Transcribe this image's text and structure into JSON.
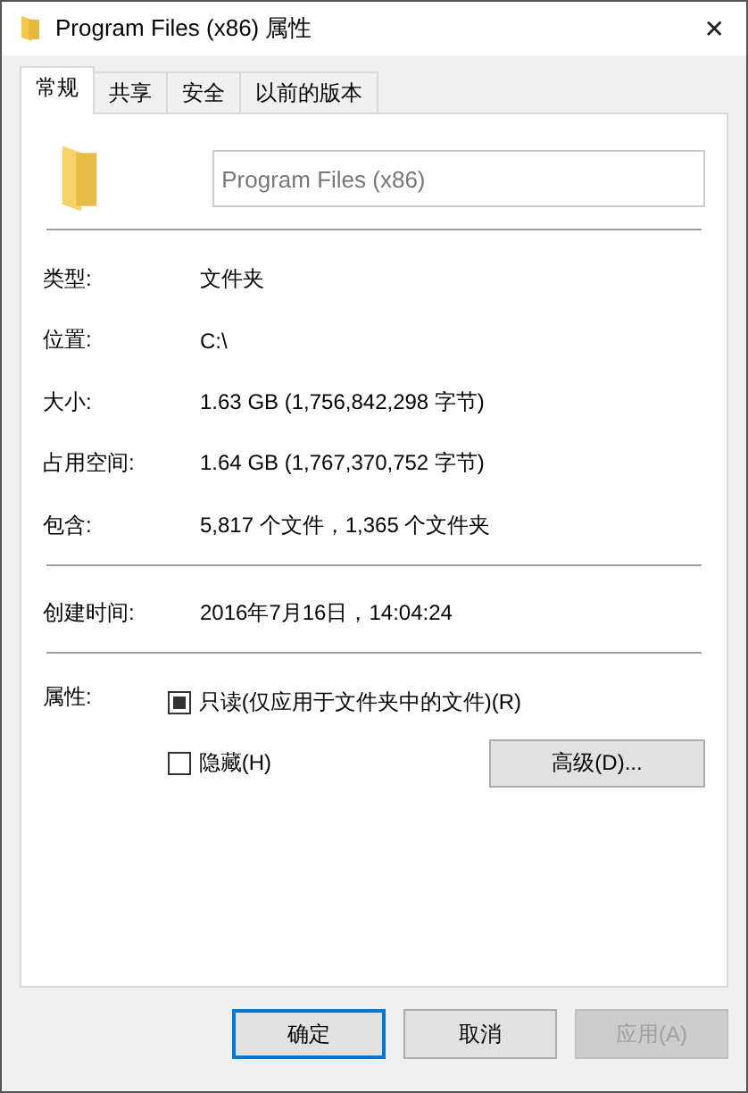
{
  "window": {
    "title": "Program Files (x86) 属性",
    "close": "✕"
  },
  "tabs": [
    {
      "label": "常规",
      "selected": true
    },
    {
      "label": "共享",
      "selected": false
    },
    {
      "label": "安全",
      "selected": false
    },
    {
      "label": "以前的版本",
      "selected": false
    }
  ],
  "name_field": {
    "value": "Program Files (x86)"
  },
  "groups": [
    [
      {
        "label": "类型:",
        "value": "文件夹"
      },
      {
        "label": "位置:",
        "value": "C:\\"
      },
      {
        "label": "大小:",
        "value": "1.63 GB (1,756,842,298 字节)"
      },
      {
        "label": "占用空间:",
        "value": "1.64 GB (1,767,370,752 字节)"
      },
      {
        "label": "包含:",
        "value": "5,817 个文件，1,365 个文件夹"
      }
    ],
    [
      {
        "label": "创建时间:",
        "value": "2016年7月16日，14:04:24"
      }
    ]
  ],
  "attributes": {
    "label": "属性:",
    "options": [
      {
        "label": "只读(仅应用于文件夹中的文件)(R)",
        "indeterminate": true
      },
      {
        "label": "隐藏(H)",
        "indeterminate": false
      }
    ],
    "advanced_button": "高级(D)..."
  },
  "buttons": [
    {
      "label": "确定",
      "default": true,
      "disabled": false
    },
    {
      "label": "取消",
      "default": false,
      "disabled": false
    },
    {
      "label": "应用(A)",
      "default": false,
      "disabled": true
    }
  ]
}
